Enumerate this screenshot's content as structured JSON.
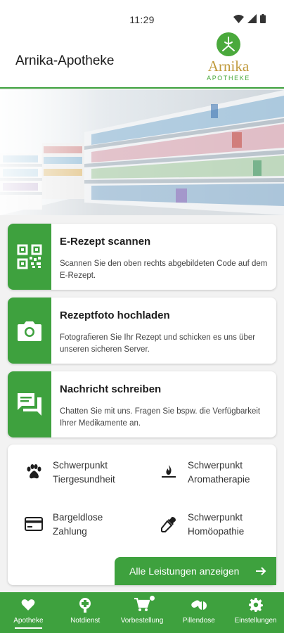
{
  "status_bar": {
    "time": "11:29"
  },
  "header": {
    "title": "Arnika-Apotheke",
    "logo_name": "Arnika",
    "logo_sub": "APOTHEKE"
  },
  "cards": [
    {
      "title": "E-Rezept scannen",
      "desc": "Scannen Sie den oben rechts abgebildeten Code auf dem E-Rezept.",
      "icon": "qr-code-icon"
    },
    {
      "title": "Rezeptfoto hochladen",
      "desc": "Fotografieren Sie Ihr Rezept und schicken es uns über unseren sicheren Server.",
      "icon": "camera-icon"
    },
    {
      "title": "Nachricht schreiben",
      "desc": "Chatten Sie mit uns. Fragen Sie bspw. die Verfügbarkeit Ihrer Medikamente an.",
      "icon": "chat-icon"
    }
  ],
  "services": [
    {
      "line1": "Schwerpunkt",
      "line2": "Tiergesundheit",
      "icon": "paw-icon"
    },
    {
      "line1": "Schwerpunkt",
      "line2": "Aromatherapie",
      "icon": "flame-icon"
    },
    {
      "line1": "Bargeldlose",
      "line2": "Zahlung",
      "icon": "credit-card-icon"
    },
    {
      "line1": "Schwerpunkt",
      "line2": "Homöopathie",
      "icon": "dropper-icon"
    }
  ],
  "all_services_label": "Alle Leistungen anzeigen",
  "nav": [
    {
      "label": "Apotheke",
      "icon": "heart-icon",
      "active": true
    },
    {
      "label": "Notdienst",
      "icon": "medical-cross-icon"
    },
    {
      "label": "Vorbestellung",
      "icon": "cart-icon"
    },
    {
      "label": "Pillendose",
      "icon": "pills-icon"
    },
    {
      "label": "Einstellungen",
      "icon": "gear-icon"
    }
  ],
  "colors": {
    "accent": "#3ea13e",
    "logo_gold": "#c09a3c"
  }
}
